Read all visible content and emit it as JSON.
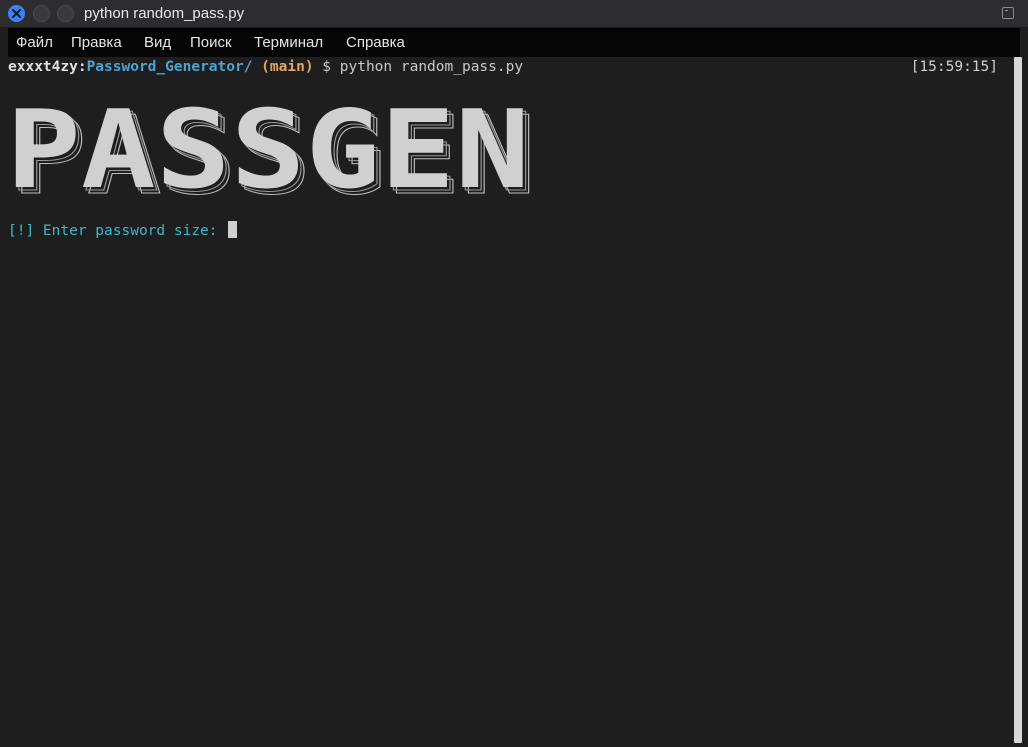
{
  "window": {
    "title": "python random_pass.py"
  },
  "menu": {
    "items": [
      "Файл",
      "Правка",
      "Вид",
      "Поиск",
      "Терминал",
      "Справка"
    ]
  },
  "terminal": {
    "prompt": {
      "user": "exxxt4zy",
      "colon": ":",
      "path": "Password_Generator/",
      "branch": " (main)",
      "command": " $ python random_pass.py"
    },
    "timestamp": "[15:59:15]",
    "banner_text": "PASSGEN",
    "input_prompt": "[!] Enter password size: "
  },
  "colors": {
    "background": "#1e1e1e",
    "path": "#4fa3d1",
    "branch": "#e0a56a",
    "input_prompt": "#3fb7c9",
    "close_button": "#3b82f6"
  }
}
